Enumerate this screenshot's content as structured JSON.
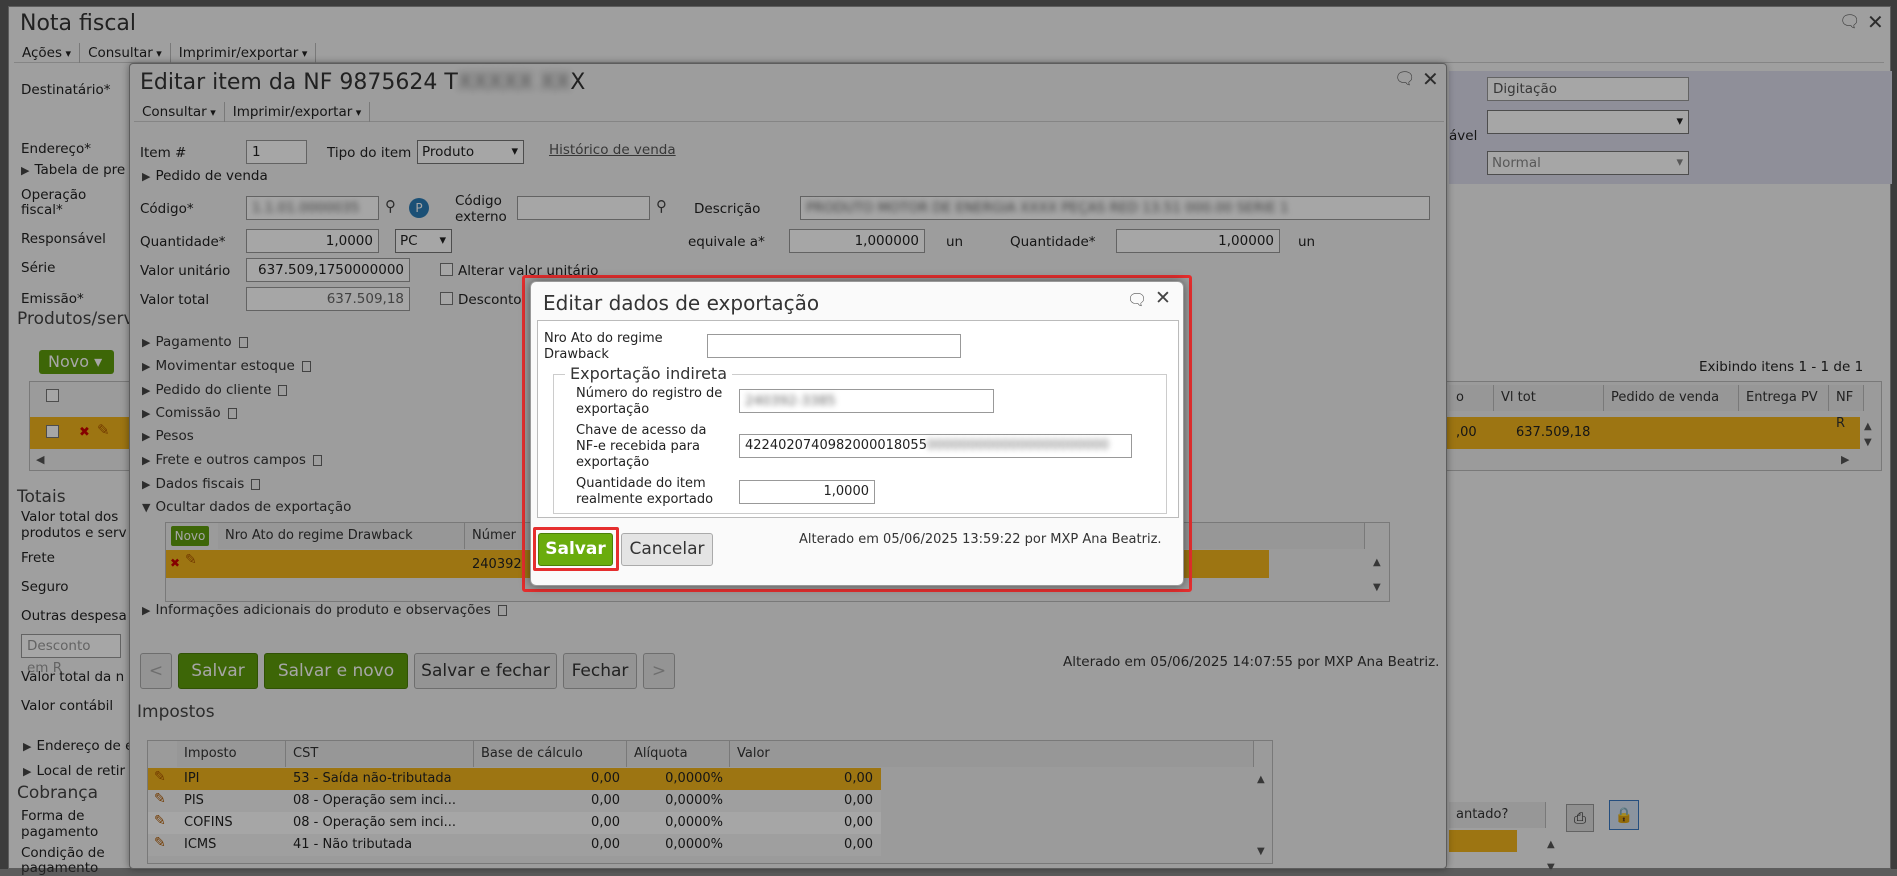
{
  "outer": {
    "title": "Nota fiscal",
    "menu": [
      "Ações",
      "Consultar",
      "Imprimir/exportar"
    ],
    "labels": {
      "destinatario": "Destinatário*",
      "endereco": "Endereço*",
      "tabela": "Tabela de pre",
      "operacao1": "Operação",
      "operacao2": "fiscal*",
      "responsavel": "Responsável",
      "serie": "Série",
      "emissao": "Emissão*",
      "produtos": "Produtos/serv",
      "totais": "Totais",
      "valor_total_produtos1": "Valor total dos",
      "valor_total_produtos2": "produtos e serv",
      "frete": "Frete",
      "seguro": "Seguro",
      "outras": "Outras despesa",
      "desconto_placeholder": "Desconto em R",
      "valor_total_nota": "Valor total da n",
      "valor_contabil": "Valor contábil",
      "endereco_de": "Endereço de e",
      "local_retirada": "Local de retir",
      "cobranca": "Cobrança",
      "forma1": "Forma de",
      "forma2": "pagamento",
      "condicao1": "Condição de",
      "condicao2": "pagamento",
      "adiantado": "antado?",
      "novo": "Novo",
      "exibindo": "Exibindo itens 1 - 1 de 1",
      "status_value": "Digitação",
      "tipo_value": "Normal",
      "vel": "ável"
    },
    "grid_headers": [
      "o",
      "Vl tot",
      "Pedido de venda",
      "Entrega PV",
      "NF R"
    ],
    "grid_row": {
      "o": ",00",
      "vl_tot": "637.509,18"
    }
  },
  "item_dialog": {
    "title": "Editar item da NF 9875624 T",
    "title_suffix": "X",
    "menu": [
      "Consultar",
      "Imprimir/exportar"
    ],
    "item_label": "Item #",
    "item_value": "1",
    "tipo_label": "Tipo do item",
    "tipo_value": "Produto",
    "historico": "Histórico de venda",
    "pedido_venda": "Pedido de venda",
    "codigo_label": "Código*",
    "codigo_externo1": "Código",
    "codigo_externo2": "externo",
    "descricao_label": "Descrição",
    "quantidade_label": "Quantidade*",
    "quantidade_value": "1,0000",
    "unidade": "PC",
    "equivale_label": "equivale a*",
    "equivale_value": "1,000000",
    "un": "un",
    "quantidade2_label": "Quantidade*",
    "quantidade2_value": "1,00000",
    "un2": "un",
    "valor_unitario_label": "Valor unitário",
    "valor_unitario_value": "637.509,1750000000",
    "alterar_label": "Alterar valor unitário",
    "valor_total_label": "Valor total",
    "valor_total_value": "637.509,18",
    "desconto_label": "Desconto",
    "sections": [
      "Pagamento",
      "Movimentar estoque",
      "Pedido do cliente",
      "Comissão",
      "Pesos",
      "Frete e outros campos",
      "Dados fiscais"
    ],
    "ocultar": "Ocultar dados de exportação",
    "export_grid": {
      "novo": "Novo",
      "col1": "Nro Ato do regime Drawback",
      "col2": "Númer",
      "row_value": "240392"
    },
    "info_adicionais": "Informações adicionais do produto e observações",
    "buttons": {
      "prev": "<",
      "salvar": "Salvar",
      "salvar_novo": "Salvar e novo",
      "salvar_fechar": "Salvar e fechar",
      "fechar": "Fechar",
      "next": ">"
    },
    "alterado": "Alterado em 05/06/2025 14:07:55 por MXP Ana Beatriz.",
    "impostos_title": "Impostos",
    "impostos_headers": [
      "Imposto",
      "CST",
      "Base de cálculo",
      "Alíquota",
      "Valor"
    ],
    "impostos_rows": [
      {
        "imposto": "IPI",
        "cst": "53 - Saída não-tributada",
        "base": "0,00",
        "aliquota": "0,0000%",
        "valor": "0,00"
      },
      {
        "imposto": "PIS",
        "cst": "08 - Operação sem inci...",
        "base": "0,00",
        "aliquota": "0,0000%",
        "valor": "0,00"
      },
      {
        "imposto": "COFINS",
        "cst": "08 - Operação sem inci...",
        "base": "0,00",
        "aliquota": "0,0000%",
        "valor": "0,00"
      },
      {
        "imposto": "ICMS",
        "cst": "41 - Não tributada",
        "base": "0,00",
        "aliquota": "0,0000%",
        "valor": "0,00"
      }
    ]
  },
  "export_dialog": {
    "title": "Editar dados de exportação",
    "nro_ato_label1": "Nro Ato do regime",
    "nro_ato_label2": "Drawback",
    "nro_ato_value": "",
    "fieldset_legend": "Exportação indireta",
    "registro_label1": "Número do registro de",
    "registro_label2": "exportação",
    "chave_label1": "Chave de acesso da",
    "chave_label2": "NF-e recebida para",
    "chave_label3": "exportação",
    "chave_value": "4224020740982000018055",
    "quantidade_label1": "Quantidade do item",
    "quantidade_label2": "realmente exportado",
    "quantidade_value": "1,0000",
    "salvar": "Salvar",
    "cancelar": "Cancelar",
    "alterado": "Alterado em 05/06/2025 13:59:22 por MXP Ana Beatriz."
  },
  "colors": {
    "accent_green": "#5f9d0c",
    "row_highlight": "#f1b41c",
    "highlight_red": "#e52e2e"
  }
}
